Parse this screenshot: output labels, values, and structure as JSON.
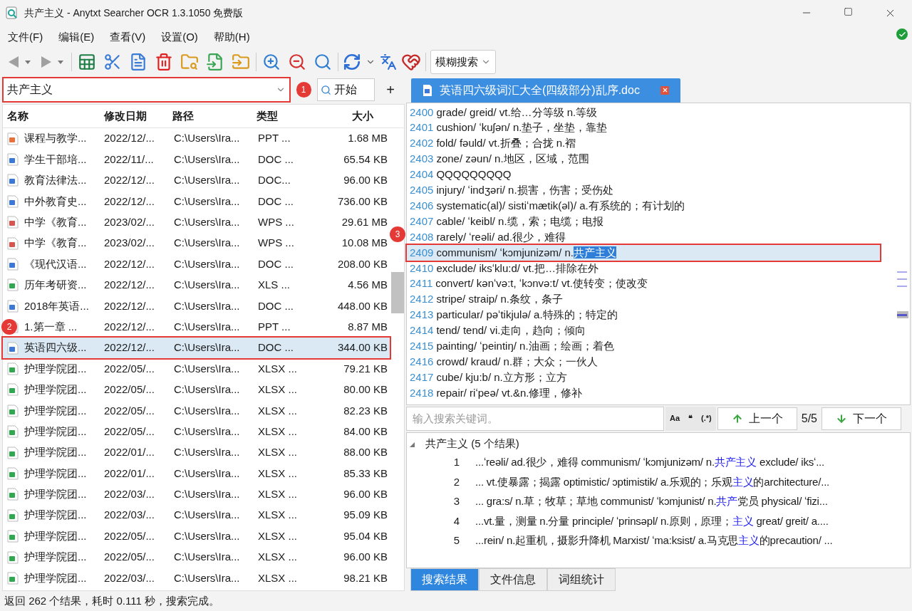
{
  "window": {
    "title": "共产主义 - Anytxt Searcher OCR 1.3.1050 免费版"
  },
  "menu": [
    "文件(F)",
    "编辑(E)",
    "查看(V)",
    "设置(O)",
    "帮助(H)"
  ],
  "toolbar": {
    "mode": "模糊搜索"
  },
  "search": {
    "value": "共产主义",
    "button": "开始",
    "add": "+",
    "callout": "1"
  },
  "file_list": {
    "columns": [
      "名称",
      "修改日期",
      "路径",
      "类型",
      "大小"
    ],
    "rows": [
      {
        "kind": "ppt",
        "name": "课程与教学...",
        "date": "2022/12/...",
        "path": "C:\\Users\\Ira...",
        "type": "PPT ...",
        "size": "1.68 MB",
        "selected": false
      },
      {
        "kind": "doc",
        "name": "学生干部培...",
        "date": "2022/11/...",
        "path": "C:\\Users\\Ira...",
        "type": "DOC ...",
        "size": "65.54 KB",
        "selected": false
      },
      {
        "kind": "doc",
        "name": "教育法律法...",
        "date": "2022/12/...",
        "path": "C:\\Users\\Ira...",
        "type": "DOC...",
        "size": "96.00 KB",
        "selected": false
      },
      {
        "kind": "doc",
        "name": "中外教育史...",
        "date": "2022/12/...",
        "path": "C:\\Users\\Ira...",
        "type": "DOC ...",
        "size": "736.00 KB",
        "selected": false
      },
      {
        "kind": "wps",
        "name": "中学《教育...",
        "date": "2023/02/...",
        "path": "C:\\Users\\Ira...",
        "type": "WPS ...",
        "size": "29.61 MB",
        "selected": false
      },
      {
        "kind": "wps",
        "name": "中学《教育...",
        "date": "2023/02/...",
        "path": "C:\\Users\\Ira...",
        "type": "WPS ...",
        "size": "10.08 MB",
        "selected": false
      },
      {
        "kind": "doc",
        "name": "《现代汉语...",
        "date": "2022/12/...",
        "path": "C:\\Users\\Ira...",
        "type": "DOC ...",
        "size": "208.00 KB",
        "selected": false
      },
      {
        "kind": "xls",
        "name": "历年考研资...",
        "date": "2022/12/...",
        "path": "C:\\Users\\Ira...",
        "type": "XLS ...",
        "size": "4.56 MB",
        "selected": false
      },
      {
        "kind": "doc",
        "name": "2018年英语...",
        "date": "2022/12/...",
        "path": "C:\\Users\\Ira...",
        "type": "DOC ...",
        "size": "448.00 KB",
        "selected": false
      },
      {
        "kind": "ppt",
        "name": "1.第一章  ...",
        "date": "2022/12/...",
        "path": "C:\\Users\\Ira...",
        "type": "PPT ...",
        "size": "8.87 MB",
        "selected": false
      },
      {
        "kind": "doc",
        "name": "英语四六级...",
        "date": "2022/12/...",
        "path": "C:\\Users\\Ira...",
        "type": "DOC ...",
        "size": "344.00 KB",
        "selected": true,
        "callout": "2"
      },
      {
        "kind": "xls",
        "name": "护理学院团...",
        "date": "2022/05/...",
        "path": "C:\\Users\\Ira...",
        "type": "XLSX ...",
        "size": "79.21 KB",
        "selected": false
      },
      {
        "kind": "xls",
        "name": "护理学院团...",
        "date": "2022/05/...",
        "path": "C:\\Users\\Ira...",
        "type": "XLSX ...",
        "size": "80.00 KB",
        "selected": false
      },
      {
        "kind": "xls",
        "name": "护理学院团...",
        "date": "2022/05/...",
        "path": "C:\\Users\\Ira...",
        "type": "XLSX ...",
        "size": "82.23 KB",
        "selected": false
      },
      {
        "kind": "xls",
        "name": "护理学院团...",
        "date": "2022/05/...",
        "path": "C:\\Users\\Ira...",
        "type": "XLSX ...",
        "size": "84.00 KB",
        "selected": false
      },
      {
        "kind": "xls",
        "name": "护理学院团...",
        "date": "2022/01/...",
        "path": "C:\\Users\\Ira...",
        "type": "XLSX ...",
        "size": "88.00 KB",
        "selected": false
      },
      {
        "kind": "xls",
        "name": "护理学院团...",
        "date": "2022/01/...",
        "path": "C:\\Users\\Ira...",
        "type": "XLSX ...",
        "size": "85.33 KB",
        "selected": false
      },
      {
        "kind": "xls",
        "name": "护理学院团...",
        "date": "2022/03/...",
        "path": "C:\\Users\\Ira...",
        "type": "XLSX ...",
        "size": "96.00 KB",
        "selected": false
      },
      {
        "kind": "xls",
        "name": "护理学院团...",
        "date": "2022/03/...",
        "path": "C:\\Users\\Ira...",
        "type": "XLSX ...",
        "size": "95.09 KB",
        "selected": false
      },
      {
        "kind": "xls",
        "name": "护理学院团...",
        "date": "2022/05/...",
        "path": "C:\\Users\\Ira...",
        "type": "XLSX ...",
        "size": "95.04 KB",
        "selected": false
      },
      {
        "kind": "xls",
        "name": "护理学院团...",
        "date": "2022/05/...",
        "path": "C:\\Users\\Ira...",
        "type": "XLSX ...",
        "size": "96.00 KB",
        "selected": false
      },
      {
        "kind": "xls",
        "name": "护理学院团...",
        "date": "2022/03/...",
        "path": "C:\\Users\\Ira...",
        "type": "XLSX ...",
        "size": "98.21 KB",
        "selected": false
      }
    ]
  },
  "viewer": {
    "tab": "英语四六级词汇大全(四级部分)乱序.doc",
    "lines": [
      {
        "number": "2400",
        "text": "grade/ greid/ vt.给…分等级 n.等级",
        "selected": false
      },
      {
        "number": "2401",
        "text": "cushion/ ʻkuʃən/ n.垫子，坐垫，靠垫",
        "selected": false
      },
      {
        "number": "2402",
        "text": "fold/ fəuld/ vt.折叠；合拢 n.褶",
        "selected": false
      },
      {
        "number": "2403",
        "text": "zone/ zəun/ n.地区，区域，范围",
        "selected": false
      },
      {
        "number": "2404",
        "text": "QQQQQQQQQ",
        "selected": false
      },
      {
        "number": "2405",
        "text": "injury/ ʻindʒəri/ n.损害，伤害；受伤处",
        "selected": false
      },
      {
        "number": "2406",
        "text": "systematic(al)/ sistiʻmætik(əl)/ a.有系统的；有计划的",
        "selected": false
      },
      {
        "number": "2407",
        "text": "cable/ ʻkeibl/ n.缆，索；电缆；电报",
        "selected": false
      },
      {
        "number": "2408",
        "text": "rarely/ ʻreəli/ ad.很少，难得",
        "selected": false
      },
      {
        "number": "2409",
        "text": "communism/ ʻkɔmjunizəm/ n.**共产主义**",
        "selected": true,
        "callout": "3"
      },
      {
        "number": "2410",
        "text": "exclude/ iksʻklu:d/ vt.把…排除在外",
        "selected": false
      },
      {
        "number": "2411",
        "text": "convert/ kənʻvə:t, ʻkɔnvə:t/ vt.使转变；使改变",
        "selected": false
      },
      {
        "number": "2412",
        "text": "stripe/ straip/ n.条纹，条子",
        "selected": false
      },
      {
        "number": "2413",
        "text": "particular/ pəʻtikjulə/ a.特殊的；特定的",
        "selected": false
      },
      {
        "number": "2414",
        "text": "tend/ tend/ vi.走向，趋向；倾向",
        "selected": false
      },
      {
        "number": "2415",
        "text": "painting/ ʻpeintiŋ/ n.油画；绘画；着色",
        "selected": false
      },
      {
        "number": "2416",
        "text": "crowd/ kraud/ n.群；大众；一伙人",
        "selected": false
      },
      {
        "number": "2417",
        "text": "cube/ kju:b/ n.立方形；立方",
        "selected": false
      },
      {
        "number": "2418",
        "text": "repair/ riʻpeə/ vt.&n.修理，修补",
        "selected": false
      }
    ]
  },
  "find_bar": {
    "placeholder": "输入搜索关键词。",
    "options": [
      "Aa",
      "❝",
      "(.*)"
    ],
    "prev": "上一个",
    "counter": "5/5",
    "next": "下一个"
  },
  "results": {
    "query": "共产主义 (5 个结果)",
    "expanded": true,
    "items": [
      {
        "index": "1",
        "snippet": "...ʻreəli/ ad.很少，难得 communism/ ʻkɔmjunizəm/ n.**共产主义** exclude/ iksʻ..."
      },
      {
        "index": "2",
        "snippet": "... vt.使暴露；揭露 optimistic/ ɔptimistik/ a.乐观的；乐观**主义**的architecture/..."
      },
      {
        "index": "3",
        "snippet": "... gra:s/ n.草；牧草；草地 communist/ ʻkɔmjunist/ n.**共产**党员 physical/ ʻfizi..."
      },
      {
        "index": "4",
        "snippet": "...vt.量，测量 n.分量 principle/ ʻprinsəpl/ n.原则，原理；**主义** great/ greit/ a...."
      },
      {
        "index": "5",
        "snippet": "...rein/ n.起重机，摄影升降机 Marxist/ ʻma:ksist/ a.马克思**主义**的precaution/ ..."
      }
    ]
  },
  "bottom_tabs": [
    {
      "label": "搜索结果",
      "selected": true
    },
    {
      "label": "文件信息",
      "selected": false
    },
    {
      "label": "词组统计",
      "selected": false
    }
  ],
  "status_bar": "返回 262 个结果，耗时 0.111 秒，搜索完成。"
}
